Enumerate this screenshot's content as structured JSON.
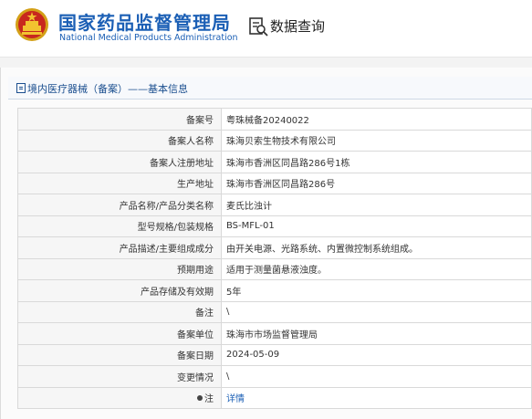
{
  "header": {
    "org_name_cn": "国家药品监督管理局",
    "org_name_en": "National Medical Products Administration",
    "query_label": "数据查询",
    "emblem_icon": "national-emblem-icon",
    "query_icon": "document-search-icon",
    "brand_color": "#1b5fb5"
  },
  "panel": {
    "title": "境内医疗器械（备案）——基本信息"
  },
  "records": [
    {
      "label": "备案号",
      "value": "粤珠械备20240022"
    },
    {
      "label": "备案人名称",
      "value": "珠海贝索生物技术有限公司"
    },
    {
      "label": "备案人注册地址",
      "value": "珠海市香洲区同昌路286号1栋"
    },
    {
      "label": "生产地址",
      "value": "珠海市香洲区同昌路286号"
    },
    {
      "label": "产品名称/产品分类名称",
      "value": "麦氏比浊计"
    },
    {
      "label": "型号规格/包装规格",
      "value": "BS-MFL-01"
    },
    {
      "label": "产品描述/主要组成成分",
      "value": "由开关电源、光路系统、内置微控制系统组成。"
    },
    {
      "label": "预期用途",
      "value": "适用于测量菌悬液浊度。"
    },
    {
      "label": "产品存储及有效期",
      "value": "5年"
    },
    {
      "label": "备注",
      "value": "\\"
    },
    {
      "label": "备案单位",
      "value": "珠海市市场监督管理局"
    },
    {
      "label": "备案日期",
      "value": "2024-05-09"
    },
    {
      "label": "变更情况",
      "value": "\\"
    },
    {
      "label": "注",
      "value": "详情"
    }
  ]
}
